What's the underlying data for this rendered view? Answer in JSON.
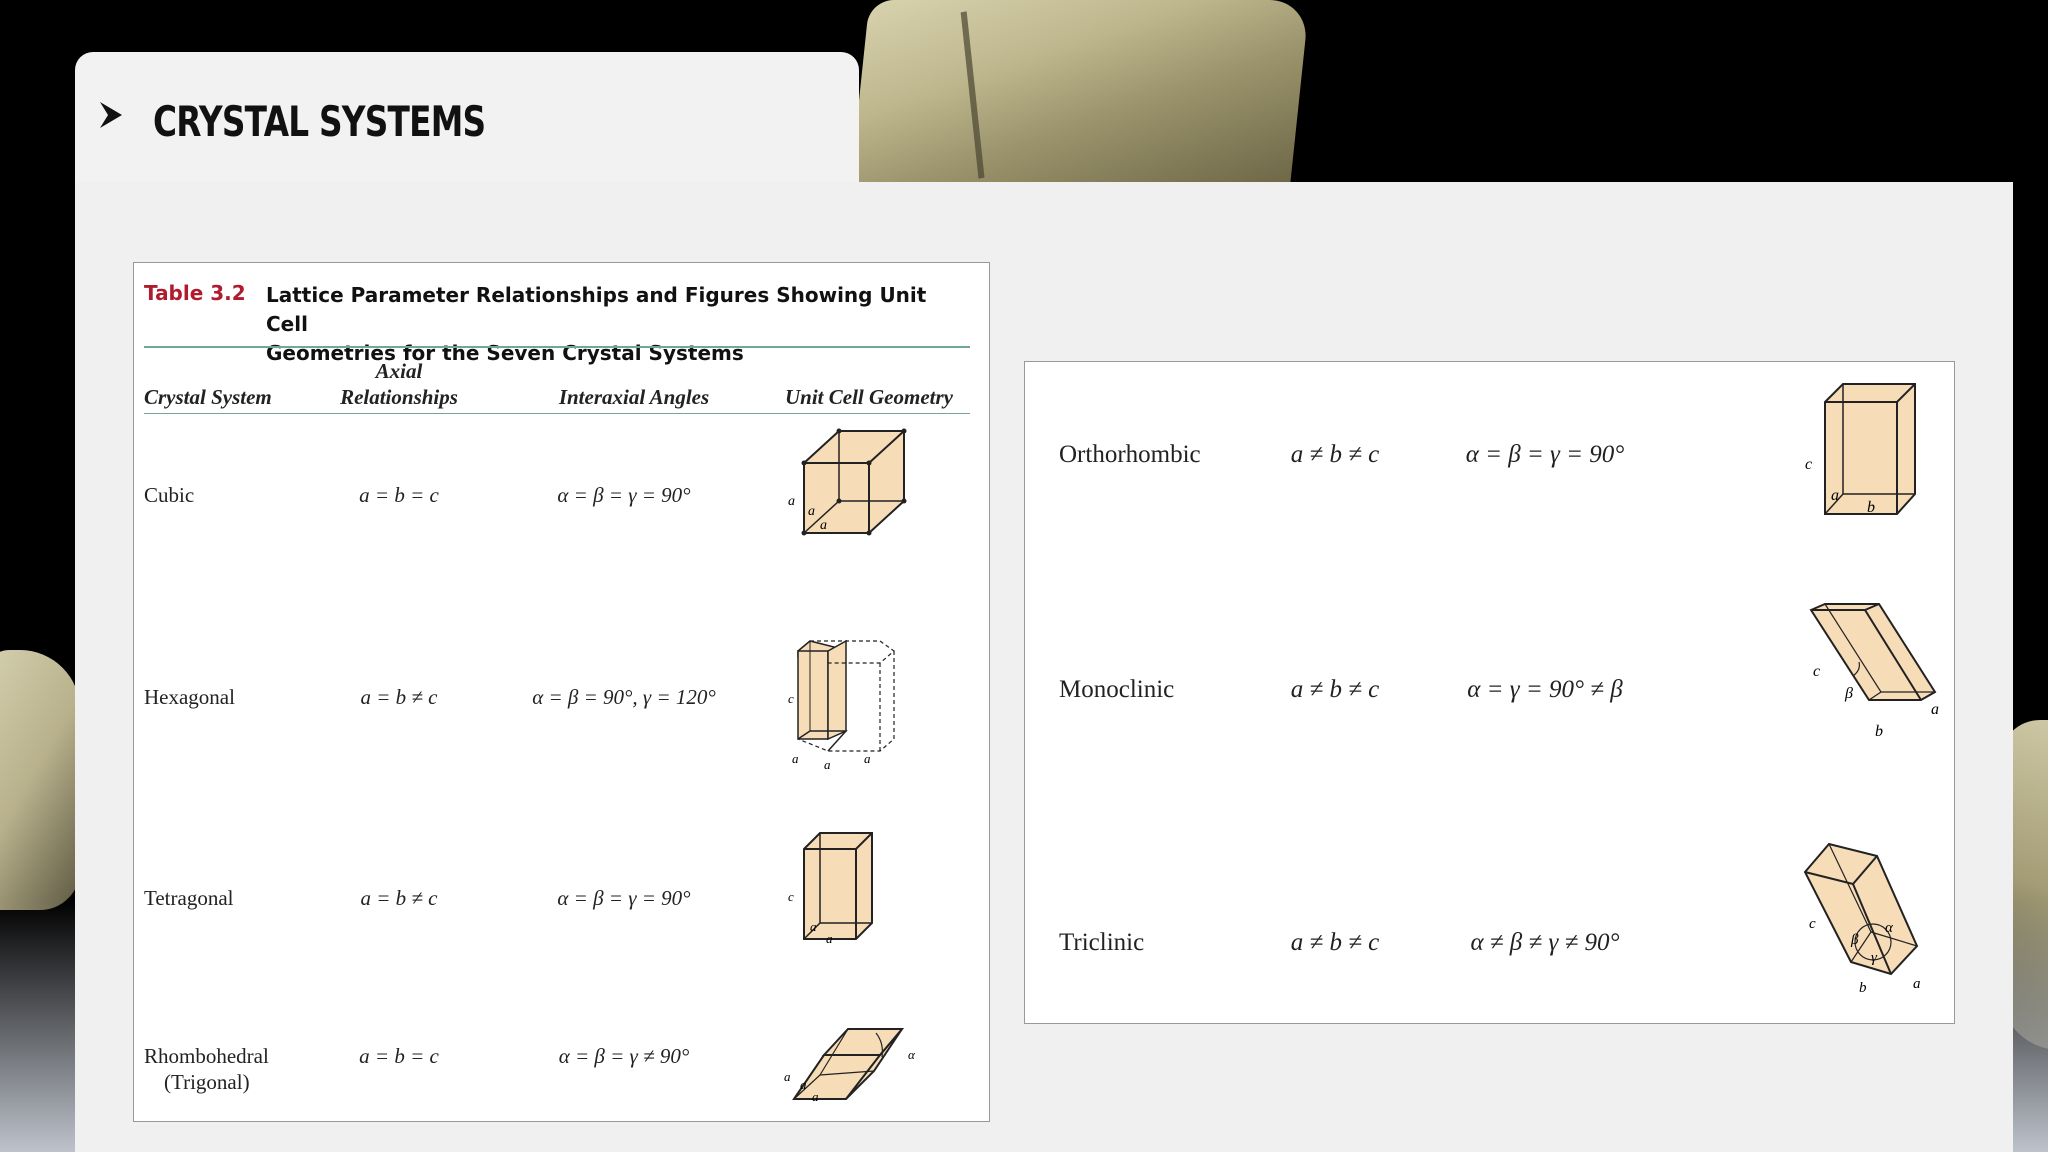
{
  "header": {
    "title": "CRYSTAL SYSTEMS"
  },
  "table": {
    "caption_label": "Table 3.2",
    "caption_line1": "Lattice Parameter Relationships and Figures Showing Unit Cell",
    "caption_line2": "Geometries for the Seven Crystal Systems",
    "columns": {
      "system": "Crystal System",
      "axial_line1": "Axial",
      "axial_line2": "Relationships",
      "angles": "Interaxial Angles",
      "geometry": "Unit Cell Geometry"
    },
    "rows_left": [
      {
        "system": "Cubic",
        "axial": "a = b = c",
        "angles": "α = β = γ = 90°"
      },
      {
        "system": "Hexagonal",
        "axial": "a = b ≠ c",
        "angles": "α = β = 90°, γ = 120°"
      },
      {
        "system": "Tetragonal",
        "axial": "a = b ≠ c",
        "angles": "α = β = γ = 90°"
      },
      {
        "system": "Rhombohedral",
        "system_line2": "(Trigonal)",
        "axial": "a = b = c",
        "angles": "α = β = γ ≠ 90°"
      }
    ],
    "rows_right": [
      {
        "system": "Orthorhombic",
        "axial": "a ≠ b ≠ c",
        "angles": "α = β = γ = 90°"
      },
      {
        "system": "Monoclinic",
        "axial": "a ≠ b ≠ c",
        "angles": "α = γ = 90° ≠ β"
      },
      {
        "system": "Triclinic",
        "axial": "a ≠ b ≠ c",
        "angles": "α ≠ β ≠ γ ≠ 90°"
      }
    ],
    "figure_labels": {
      "a": "a",
      "b": "b",
      "c": "c",
      "alpha": "α",
      "beta": "β",
      "gamma": "γ"
    }
  },
  "colors": {
    "cell_fill": "#f7dcb8",
    "caption_red": "#b01c2e",
    "rule_teal": "#6fa89a",
    "panel": "#f0f0f0"
  }
}
